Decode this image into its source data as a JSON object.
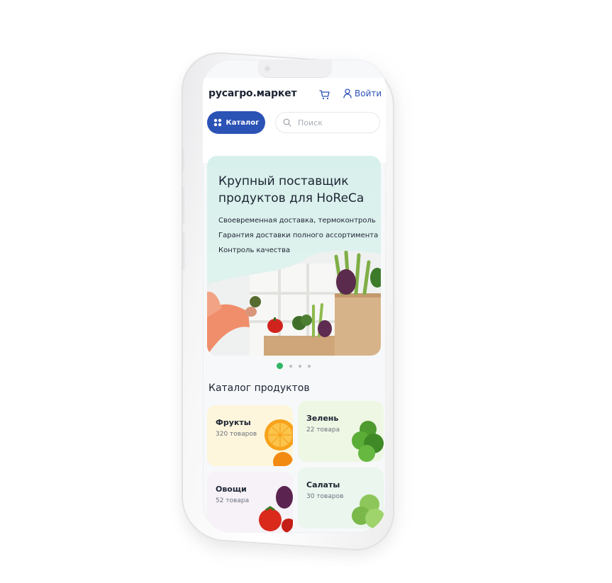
{
  "header": {
    "logo": "русагро.маркет",
    "login_label": "Войти",
    "catalog_label": "Каталог",
    "search_placeholder": "Поиск"
  },
  "banner": {
    "title": "Крупный поставщик продуктов для HoReCa",
    "lines": [
      "Своевременная доставка, термоконтроль",
      "Гарантия доставки полного ассортимента",
      "Контроль качества"
    ],
    "slides_total": 4,
    "active_slide": 1
  },
  "catalog": {
    "heading": "Каталог продуктов",
    "categories": [
      {
        "name": "Фрукты",
        "count": "320 товаров",
        "bg": "#fdf6dc"
      },
      {
        "name": "Зелень",
        "count": "22 товара",
        "bg": "#eef7e4"
      },
      {
        "name": "Овощи",
        "count": "52 товара",
        "bg": "#f6f2f7"
      },
      {
        "name": "Салаты",
        "count": "30 товаров",
        "bg": "#eaf6ee"
      }
    ]
  },
  "colors": {
    "accent": "#2b52b5",
    "active_dot": "#2fb565",
    "text": "#1d2433"
  },
  "icons": [
    "cart-icon",
    "user-icon",
    "grid-icon",
    "search-icon"
  ]
}
